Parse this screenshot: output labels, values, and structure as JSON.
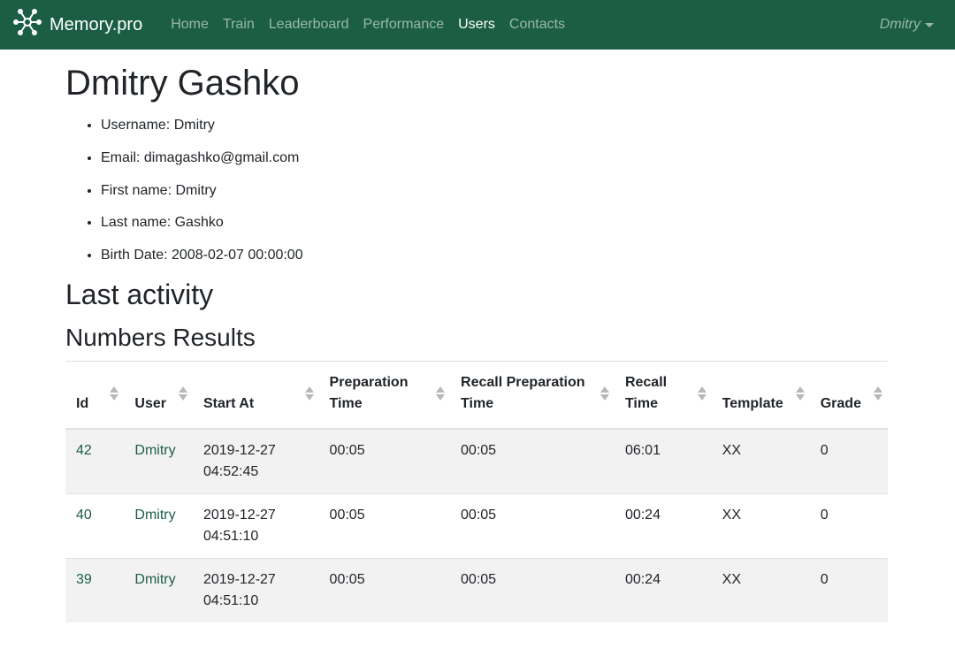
{
  "navbar": {
    "brand": "Memory.pro",
    "items": [
      {
        "label": "Home"
      },
      {
        "label": "Train"
      },
      {
        "label": "Leaderboard"
      },
      {
        "label": "Performance"
      },
      {
        "label": "Users",
        "active": true
      },
      {
        "label": "Contacts"
      }
    ],
    "user": "Dmitry",
    "color": "#1b5e45"
  },
  "profile": {
    "name": "Dmitry Gashko",
    "details": [
      "Username: Dmitry",
      "Email: dimagashko@gmail.com",
      "First name: Dmitry",
      "Last name: Gashko",
      "Birth Date: 2008-02-07 00:00:00"
    ]
  },
  "activity": {
    "title": "Last activity",
    "subtitle": "Numbers Results",
    "columns": [
      "Id",
      "User",
      "Start At",
      "Preparation Time",
      "Recall Preparation Time",
      "Recall Time",
      "Template",
      "Grade"
    ],
    "rows": [
      {
        "id": "42",
        "user": "Dmitry",
        "start_date": "2019-12-27",
        "start_time": "04:52:45",
        "prep": "00:05",
        "recall_prep": "00:05",
        "recall": "06:01",
        "template": "XX",
        "grade": "0"
      },
      {
        "id": "40",
        "user": "Dmitry",
        "start_date": "2019-12-27",
        "start_time": "04:51:10",
        "prep": "00:05",
        "recall_prep": "00:05",
        "recall": "00:24",
        "template": "XX",
        "grade": "0"
      },
      {
        "id": "39",
        "user": "Dmitry",
        "start_date": "2019-12-27",
        "start_time": "04:51:10",
        "prep": "00:05",
        "recall_prep": "00:05",
        "recall": "00:24",
        "template": "XX",
        "grade": "0"
      }
    ]
  }
}
